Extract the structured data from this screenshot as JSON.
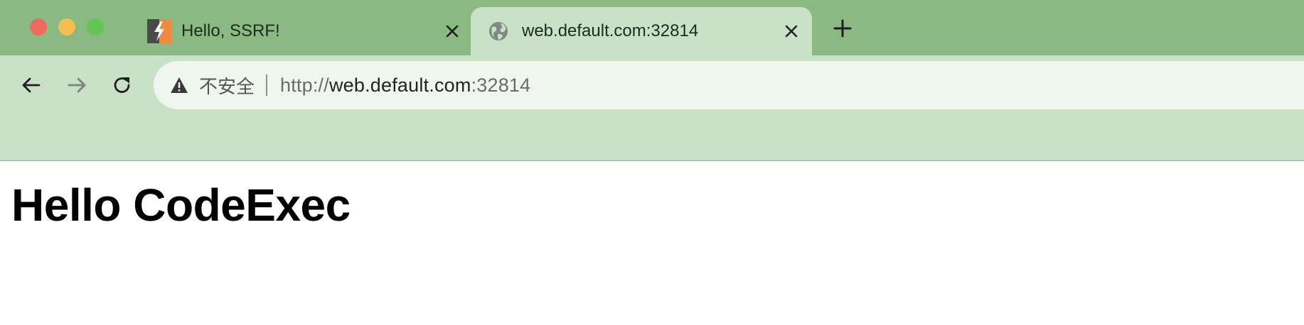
{
  "window": {
    "buttons": {
      "close_color": "#ee6a5f",
      "minimize_color": "#f5be4f",
      "maximize_color": "#62c554"
    }
  },
  "tabs": [
    {
      "title": "Hello, SSRF!",
      "favicon": "burp-suite-icon",
      "active": false
    },
    {
      "title": "web.default.com:32814",
      "favicon": "globe-icon",
      "active": true
    }
  ],
  "new_tab": {
    "icon": "plus-icon"
  },
  "navigation": {
    "back_icon": "arrow-left-icon",
    "forward_icon": "arrow-right-icon",
    "reload_icon": "reload-icon"
  },
  "address_bar": {
    "security_icon": "warning-triangle-icon",
    "security_label": "不安全",
    "url_scheme": "http://",
    "url_host": "web.default.com",
    "url_port": ":32814"
  },
  "page": {
    "heading": "Hello CodeExec"
  },
  "colors": {
    "tab_strip": "#8aba82",
    "toolbar": "#c9e1c6",
    "omnibox": "#eff6ee"
  }
}
